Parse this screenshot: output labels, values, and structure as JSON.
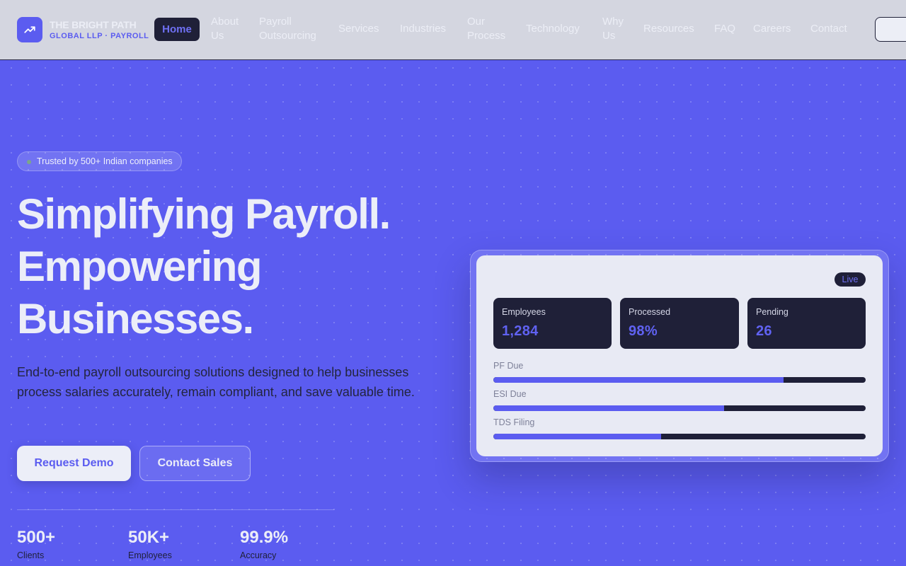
{
  "brand": {
    "name": "THE BRIGHT PATH",
    "subtitle": "GLOBAL LLP · PAYROLL",
    "logo_icon": "trending-up-icon",
    "accent_color": "#5b5cf0"
  },
  "nav": {
    "items": [
      {
        "label": "Home",
        "active": true
      },
      {
        "line1": "About",
        "line2": "Us"
      },
      {
        "line1": "Payroll",
        "line2": "Outsourcing"
      },
      {
        "label": "Services"
      },
      {
        "label": "Industries"
      },
      {
        "line1": "Our",
        "line2": "Process"
      },
      {
        "label": "Technology"
      },
      {
        "line1": "Why",
        "line2": "Us"
      },
      {
        "label": "Resources"
      },
      {
        "label": "FAQ"
      },
      {
        "label": "Careers"
      },
      {
        "label": "Contact"
      }
    ]
  },
  "hero": {
    "badge": "Trusted by 500+ Indian companies",
    "title_lines": [
      "Simplifying Payroll.",
      "Empowering",
      "Businesses."
    ],
    "description": "End-to-end payroll outsourcing solutions designed to help businesses process salaries accurately, remain compliant, and save valuable time.",
    "primary_button": "Request Demo",
    "secondary_button": "Contact Sales",
    "stats": [
      {
        "value": "500+",
        "label": "Clients"
      },
      {
        "value": "50K+",
        "label": "Employees"
      },
      {
        "value": "99.9%",
        "label": "Accuracy"
      }
    ]
  },
  "dashboard": {
    "status": "Live",
    "metrics": [
      {
        "label": "Employees",
        "value": "1,284"
      },
      {
        "label": "Processed",
        "value": "98%"
      },
      {
        "label": "Pending",
        "value": "26"
      }
    ],
    "progress": [
      {
        "label": "PF Due",
        "percent": 78
      },
      {
        "label": "ESI Due",
        "percent": 62
      },
      {
        "label": "TDS Filing",
        "percent": 45
      }
    ]
  }
}
